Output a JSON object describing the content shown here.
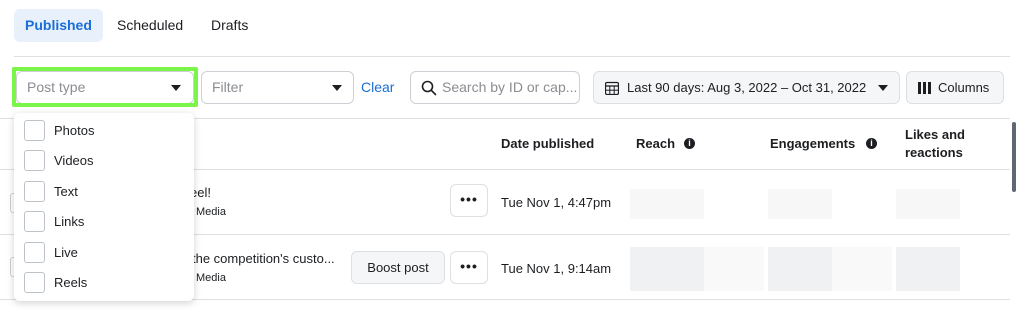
{
  "tabs": [
    {
      "label": "Published"
    },
    {
      "label": "Scheduled"
    },
    {
      "label": "Drafts"
    }
  ],
  "filters": {
    "post_type_placeholder": "Post type",
    "filter_placeholder": "Filter",
    "clear_label": "Clear",
    "search_placeholder": "Search by ID or cap...",
    "date_range_label": "Last 90 days: Aug 3, 2022 – Oct 31, 2022",
    "columns_label": "Columns"
  },
  "post_type_options": [
    {
      "label": "Photos"
    },
    {
      "label": "Videos"
    },
    {
      "label": "Text"
    },
    {
      "label": "Links"
    },
    {
      "label": "Live"
    },
    {
      "label": "Reels"
    }
  ],
  "table": {
    "headers": {
      "date_published": "Date published",
      "reach": "Reach",
      "engagements": "Engagements",
      "likes_line1": "Likes and",
      "likes_line2": "reactions"
    },
    "rows": [
      {
        "title_fragment": "eel!",
        "subtitle_fragment": "Media",
        "date": "Tue Nov 1, 4:47pm",
        "boost_label": ""
      },
      {
        "title_fragment": "the competition's custo...",
        "subtitle_fragment": "Media",
        "date": "Tue Nov 1, 9:14am",
        "boost_label": "Boost post"
      }
    ]
  },
  "colors": {
    "accent": "#1a6ed8",
    "highlight": "#7cf54a"
  },
  "icons": {
    "search": "magnifier",
    "calendar": "calendar-grid",
    "columns": "three-bars",
    "info": "info-circle",
    "more": "ellipsis"
  }
}
